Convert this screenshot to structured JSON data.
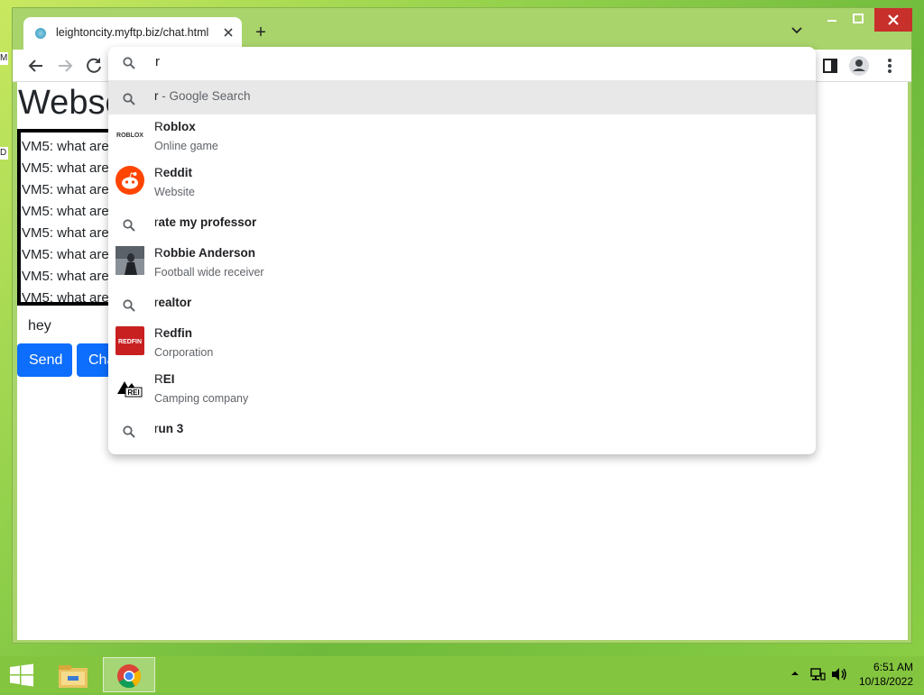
{
  "desktop": {
    "side_labels": [
      "M",
      "D"
    ]
  },
  "browser": {
    "tab": {
      "title": "leightoncity.myftp.biz/chat.html"
    },
    "new_tab_label": "+"
  },
  "page": {
    "title": "Websocket",
    "log_lines": [
      "VM5: what are",
      "VM5: what are",
      "VM5: what are",
      "VM5: what are",
      "VM5: what are",
      "VM5: what are",
      "VM5: what are",
      "VM5: what are"
    ],
    "message_value": "hey",
    "send_label": "Send",
    "chat_label": "Cha"
  },
  "omnibox": {
    "query": "r",
    "suggestions": [
      {
        "type": "search",
        "typed": "r",
        "rest": " - Google Search",
        "subtitle": "",
        "icon": "search-icon"
      },
      {
        "type": "entity",
        "typed": "R",
        "rest": "oblox",
        "subtitle": "Online game",
        "icon": "roblox-logo",
        "icon_text": "ROBLOX"
      },
      {
        "type": "entity",
        "typed": "R",
        "rest": "eddit",
        "subtitle": "Website",
        "icon": "reddit-logo"
      },
      {
        "type": "search",
        "typed": "r",
        "rest": "ate my professor",
        "subtitle": "",
        "icon": "search-icon"
      },
      {
        "type": "entity",
        "typed": "R",
        "rest": "obbie Anderson",
        "subtitle": "Football wide receiver",
        "icon": "person-photo"
      },
      {
        "type": "search",
        "typed": "r",
        "rest": "ealtor",
        "subtitle": "",
        "icon": "search-icon"
      },
      {
        "type": "entity",
        "typed": "R",
        "rest": "edfin",
        "subtitle": "Corporation",
        "icon": "redfin-logo",
        "icon_text": "REDFIN"
      },
      {
        "type": "entity",
        "typed": "R",
        "rest": "EI",
        "subtitle": "Camping company",
        "icon": "rei-logo",
        "icon_text": "REI"
      },
      {
        "type": "search",
        "typed": "r",
        "rest": "un 3",
        "subtitle": "",
        "icon": "search-icon"
      }
    ]
  },
  "taskbar": {
    "time": "6:51 AM",
    "date": "10/18/2022"
  }
}
